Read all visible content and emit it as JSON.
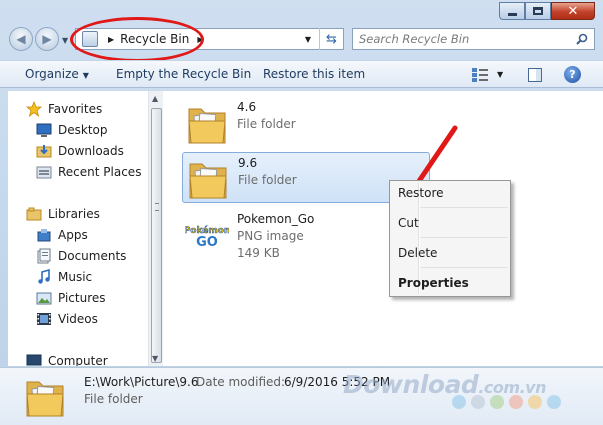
{
  "window": {
    "caption_buttons": [
      "minimize",
      "maximize",
      "close"
    ]
  },
  "address_bar": {
    "location": "Recycle Bin",
    "icon": "recycle-bin-icon"
  },
  "search": {
    "placeholder": "Search Recycle Bin"
  },
  "toolbar": {
    "organize_label": "Organize",
    "empty_label": "Empty the Recycle Bin",
    "restore_label": "Restore this item"
  },
  "sidebar": {
    "favorites": {
      "label": "Favorites",
      "items": [
        {
          "label": "Desktop",
          "icon": "desktop-icon"
        },
        {
          "label": "Downloads",
          "icon": "downloads-folder-icon"
        },
        {
          "label": "Recent Places",
          "icon": "recent-places-icon"
        }
      ]
    },
    "libraries": {
      "label": "Libraries",
      "items": [
        {
          "label": "Apps",
          "icon": "apps-icon"
        },
        {
          "label": "Documents",
          "icon": "documents-icon"
        },
        {
          "label": "Music",
          "icon": "music-icon"
        },
        {
          "label": "Pictures",
          "icon": "pictures-icon"
        },
        {
          "label": "Videos",
          "icon": "videos-icon"
        }
      ]
    },
    "computer": {
      "label": "Computer"
    }
  },
  "files": [
    {
      "name": "4.6",
      "type": "File folder",
      "size": "",
      "icon": "folder-icon",
      "selected": false
    },
    {
      "name": "9.6",
      "type": "File folder",
      "size": "",
      "icon": "folder-icon",
      "selected": true
    },
    {
      "name": "Pokemon_Go",
      "type": "PNG image",
      "size": "149 KB",
      "icon": "pokemon-go-thumbnail",
      "selected": false
    }
  ],
  "context_menu": {
    "items": [
      "Restore",
      "Cut",
      "Delete",
      "Properties"
    ],
    "bold_item": "Properties"
  },
  "details": {
    "path": "E:\\Work\\Picture\\9.6",
    "date_label": "Date modified:",
    "date_value": "6/9/2016 5:52 PM",
    "type": "File folder"
  },
  "watermark": {
    "text": "Download",
    "suffix": ".com.vn",
    "dot_colors": [
      "#8ec6ea",
      "#b9c7d6",
      "#a8d08d",
      "#f2a38c",
      "#f6c56b",
      "#8ec6ea"
    ]
  },
  "colors": {
    "annotation_red": "#e01818",
    "selection": "#cfe2f7"
  }
}
